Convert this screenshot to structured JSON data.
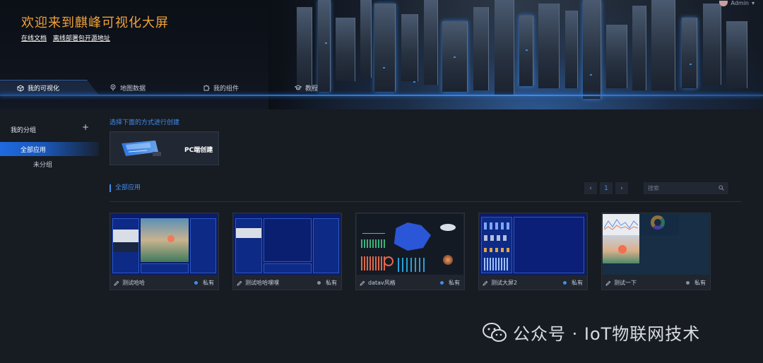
{
  "header": {
    "title": "欢迎来到麒峰可视化大屏",
    "links": [
      "在线文档",
      "离线部署包开源地址"
    ],
    "user": "Admin"
  },
  "nav": {
    "tabs": [
      {
        "label": "我的可视化",
        "icon": "cube-icon",
        "active": true
      },
      {
        "label": "地图数据",
        "icon": "map-pin-icon"
      },
      {
        "label": "我的组件",
        "icon": "puzzle-icon"
      },
      {
        "label": "教程",
        "icon": "graduation-cap-icon"
      }
    ]
  },
  "sidebar": {
    "group_title": "我的分组",
    "add_symbol": "+",
    "items": [
      {
        "label": "全部应用",
        "active": true
      },
      {
        "label": "未分组"
      }
    ]
  },
  "main": {
    "create_prompt": "选择下面的方式进行创建",
    "create_card_label": "PC端创建",
    "section_title": "全部应用",
    "pager": {
      "prev": "‹",
      "current": "1",
      "next": "›"
    },
    "search_placeholder": "搜索",
    "apps": [
      {
        "name": "测试哈哈",
        "status": "私有",
        "dot_color": "#3f8ff0"
      },
      {
        "name": "测试哈哈嘿嘿",
        "status": "私有",
        "dot_color": "#8a9099"
      },
      {
        "name": "datav风格",
        "status": "私有",
        "dot_color": "#3f8ff0"
      },
      {
        "name": "测试大屏2",
        "status": "私有",
        "dot_color": "#3f8ff0"
      },
      {
        "name": "测试一下",
        "status": "私有",
        "dot_color": "#8a9099"
      }
    ]
  },
  "watermark": {
    "text": "公众号 · IoT物联网技术",
    "icon": "wechat-icon"
  },
  "colors": {
    "accent": "#3f8ff0",
    "title_orange": "#f0a23a",
    "bg": "#171b22"
  }
}
